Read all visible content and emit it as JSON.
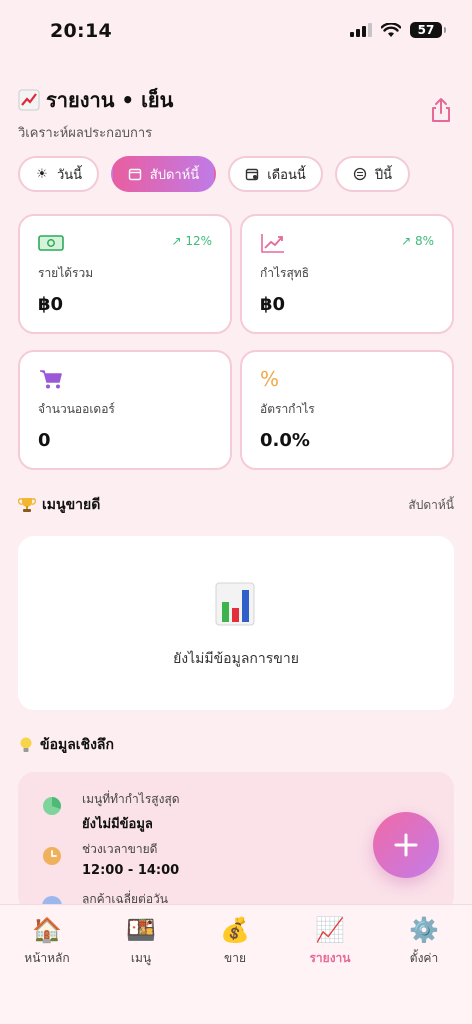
{
  "status_bar": {
    "time": "20:14",
    "battery": "57"
  },
  "header": {
    "title": "รายงาน • เย็น",
    "subtitle": "วิเคราะห์ผลประกอบการ",
    "title_icon": "chart-up-emoji"
  },
  "tabs": [
    {
      "label": "วันนี้",
      "icon": "sun-icon",
      "active": false
    },
    {
      "label": "สัปดาห์นี้",
      "icon": "calendar-icon",
      "active": true
    },
    {
      "label": "เดือนนี้",
      "icon": "calendar-month-icon",
      "active": false
    },
    {
      "label": "ปีนี้",
      "icon": "database-icon",
      "active": false
    }
  ],
  "stats": {
    "revenue": {
      "label": "รายได้รวม",
      "value": "฿0",
      "trend": "↗ 12%",
      "icon": "cash-icon"
    },
    "profit": {
      "label": "กำไรสุทธิ",
      "value": "฿0",
      "trend": "↗ 8%",
      "icon": "trend-up-icon"
    },
    "orders": {
      "label": "จำนวนออเดอร์",
      "value": "0",
      "icon": "cart-icon"
    },
    "margin": {
      "label": "อัตรากำไร",
      "value": "0.0%",
      "icon": "percent-icon"
    }
  },
  "bestsellers": {
    "title": "เมนูขายดี",
    "link": "สัปดาห์นี้",
    "empty_text": "ยังไม่มีข้อมูลการขาย"
  },
  "insights": {
    "title": "ข้อมูลเชิงลึก",
    "items": [
      {
        "label": "เมนูที่ทำกำไรสูงสุด",
        "value": "ยังไม่มีข้อมูล",
        "color": "#7fd49c"
      },
      {
        "label": "ช่วงเวลาขายดี",
        "value": "12:00 - 14:00",
        "color": "#f0b15d"
      },
      {
        "label": "ลูกค้าเฉลี่ยต่อวัน",
        "value": "",
        "color": "#9bb7ee"
      }
    ]
  },
  "nav": [
    {
      "label": "หน้าหลัก",
      "icon": "🏠",
      "active": false
    },
    {
      "label": "เมนู",
      "icon": "🍱",
      "active": false
    },
    {
      "label": "ขาย",
      "icon": "💰",
      "active": false
    },
    {
      "label": "รายงาน",
      "icon": "📈",
      "active": true
    },
    {
      "label": "ตั้งค่า",
      "icon": "⚙️",
      "active": false
    }
  ],
  "colors": {
    "accent": "#e95ea0",
    "accent2": "#c07be6",
    "trend": "#3fba79",
    "background": "#fdeef2"
  }
}
